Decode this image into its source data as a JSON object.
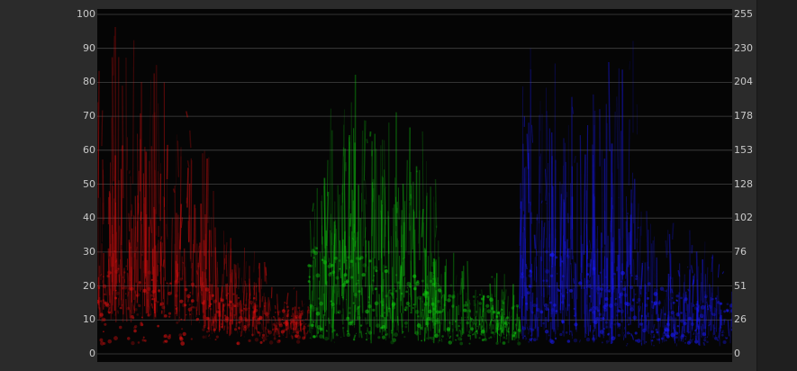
{
  "scope": {
    "type": "RGB parade waveform",
    "left_axis": {
      "ticks": [
        "100",
        "90",
        "80",
        "70",
        "60",
        "50",
        "40",
        "30",
        "20",
        "10",
        "0"
      ]
    },
    "right_axis": {
      "ticks": [
        "255",
        "230",
        "204",
        "178",
        "153",
        "128",
        "102",
        "76",
        "51",
        "26",
        "0"
      ]
    },
    "channels": [
      {
        "name": "red",
        "color": "#e01010"
      },
      {
        "name": "green",
        "color": "#10d010"
      },
      {
        "name": "blue",
        "color": "#1a1aff"
      }
    ],
    "colors": {
      "background": "#2b2b2b",
      "plot_background": "#050505",
      "gridline": "#444444",
      "tick_text": "#c9c9c9"
    }
  }
}
